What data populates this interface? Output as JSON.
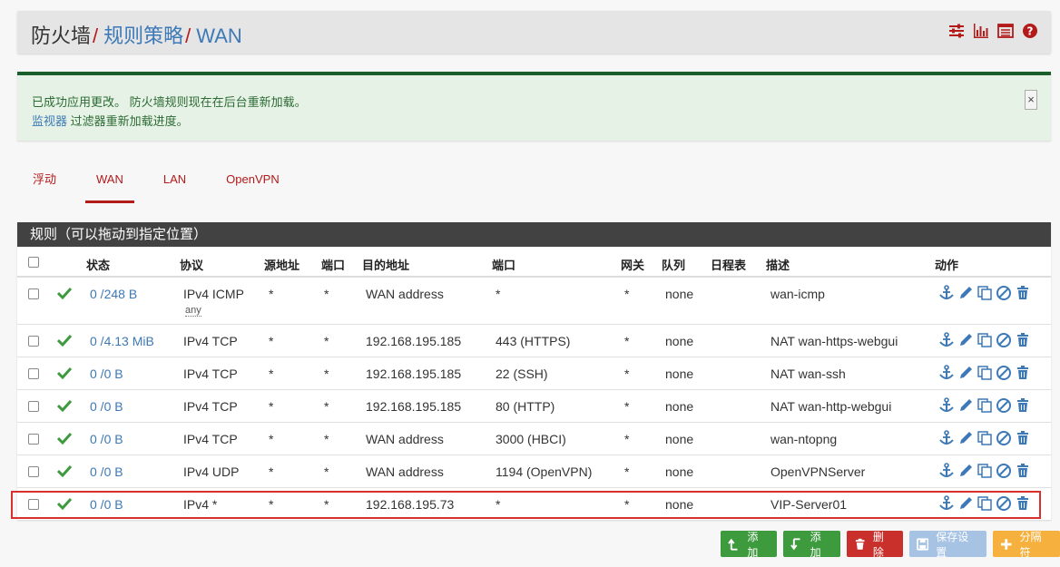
{
  "header": {
    "crumb1": "防火墙",
    "crumb2": "规则策略",
    "crumb3": "WAN",
    "sep": "/",
    "icons": [
      "sliders-icon",
      "bar-chart-icon",
      "list-icon",
      "help-icon"
    ]
  },
  "alert": {
    "line1": "已成功应用更改。 防火墙规则现在在后台重新加载。",
    "line2_link": "监视器",
    "line2_text": " 过滤器重新加载进度。",
    "close": "×"
  },
  "tabs": [
    {
      "label": "浮动",
      "active": false
    },
    {
      "label": "WAN",
      "active": true
    },
    {
      "label": "LAN",
      "active": false
    },
    {
      "label": "OpenVPN",
      "active": false
    }
  ],
  "panel": {
    "title": "规则（可以拖动到指定位置）",
    "columns": {
      "states": "状态",
      "protocol": "协议",
      "source": "源地址",
      "port": "端口",
      "destination": "目的地址",
      "dest_port": "端口",
      "gateway": "网关",
      "queue": "队列",
      "schedule": "日程表",
      "description": "描述",
      "actions": "动作"
    },
    "rows": [
      {
        "states": "0 /248 B",
        "protocol": "IPv4 ICMP",
        "protocol_sub": "any",
        "source": "*",
        "port": "*",
        "destination": "WAN address",
        "dest_port": "*",
        "gateway": "*",
        "queue": "none",
        "schedule": "",
        "description": "wan-icmp"
      },
      {
        "states": "0 /4.13 MiB",
        "protocol": "IPv4 TCP",
        "source": "*",
        "port": "*",
        "destination": "192.168.195.185",
        "dest_port": "443 (HTTPS)",
        "gateway": "*",
        "queue": "none",
        "schedule": "",
        "description": "NAT wan-https-webgui"
      },
      {
        "states": "0 /0 B",
        "protocol": "IPv4 TCP",
        "source": "*",
        "port": "*",
        "destination": "192.168.195.185",
        "dest_port": "22 (SSH)",
        "gateway": "*",
        "queue": "none",
        "schedule": "",
        "description": "NAT wan-ssh"
      },
      {
        "states": "0 /0 B",
        "protocol": "IPv4 TCP",
        "source": "*",
        "port": "*",
        "destination": "192.168.195.185",
        "dest_port": "80 (HTTP)",
        "gateway": "*",
        "queue": "none",
        "schedule": "",
        "description": "NAT wan-http-webgui"
      },
      {
        "states": "0 /0 B",
        "protocol": "IPv4 TCP",
        "source": "*",
        "port": "*",
        "destination": "WAN address",
        "dest_port": "3000 (HBCI)",
        "gateway": "*",
        "queue": "none",
        "schedule": "",
        "description": "wan-ntopng"
      },
      {
        "states": "0 /0 B",
        "protocol": "IPv4 UDP",
        "source": "*",
        "port": "*",
        "destination": "WAN address",
        "dest_port": "1194 (OpenVPN)",
        "gateway": "*",
        "queue": "none",
        "schedule": "",
        "description": "OpenVPNServer"
      },
      {
        "states": "0 /0 B",
        "protocol": "IPv4 *",
        "source": "*",
        "port": "*",
        "destination": "192.168.195.73",
        "dest_port": "*",
        "gateway": "*",
        "queue": "none",
        "schedule": "",
        "description": "VIP-Server01"
      }
    ]
  },
  "buttons": {
    "add_top": "添加",
    "add_bottom": "添加",
    "delete": "删除",
    "save": "保存设置",
    "separator": "分隔符"
  },
  "colors": {
    "accent_red": "#b31a1a",
    "link_blue": "#3d79b6",
    "success_green": "#3d9a3d",
    "highlight_red": "#d9302c"
  }
}
